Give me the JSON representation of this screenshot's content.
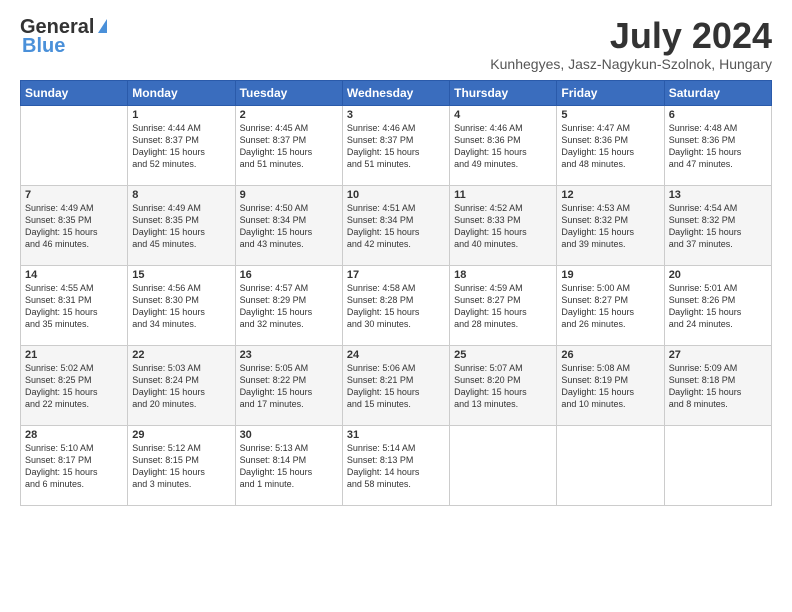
{
  "logo": {
    "line1": "General",
    "line2": "Blue"
  },
  "title": "July 2024",
  "location": "Kunhegyes, Jasz-Nagykun-Szolnok, Hungary",
  "days_header": [
    "Sunday",
    "Monday",
    "Tuesday",
    "Wednesday",
    "Thursday",
    "Friday",
    "Saturday"
  ],
  "weeks": [
    [
      {
        "day": "",
        "info": ""
      },
      {
        "day": "1",
        "info": "Sunrise: 4:44 AM\nSunset: 8:37 PM\nDaylight: 15 hours\nand 52 minutes."
      },
      {
        "day": "2",
        "info": "Sunrise: 4:45 AM\nSunset: 8:37 PM\nDaylight: 15 hours\nand 51 minutes."
      },
      {
        "day": "3",
        "info": "Sunrise: 4:46 AM\nSunset: 8:37 PM\nDaylight: 15 hours\nand 51 minutes."
      },
      {
        "day": "4",
        "info": "Sunrise: 4:46 AM\nSunset: 8:36 PM\nDaylight: 15 hours\nand 49 minutes."
      },
      {
        "day": "5",
        "info": "Sunrise: 4:47 AM\nSunset: 8:36 PM\nDaylight: 15 hours\nand 48 minutes."
      },
      {
        "day": "6",
        "info": "Sunrise: 4:48 AM\nSunset: 8:36 PM\nDaylight: 15 hours\nand 47 minutes."
      }
    ],
    [
      {
        "day": "7",
        "info": "Sunrise: 4:49 AM\nSunset: 8:35 PM\nDaylight: 15 hours\nand 46 minutes."
      },
      {
        "day": "8",
        "info": "Sunrise: 4:49 AM\nSunset: 8:35 PM\nDaylight: 15 hours\nand 45 minutes."
      },
      {
        "day": "9",
        "info": "Sunrise: 4:50 AM\nSunset: 8:34 PM\nDaylight: 15 hours\nand 43 minutes."
      },
      {
        "day": "10",
        "info": "Sunrise: 4:51 AM\nSunset: 8:34 PM\nDaylight: 15 hours\nand 42 minutes."
      },
      {
        "day": "11",
        "info": "Sunrise: 4:52 AM\nSunset: 8:33 PM\nDaylight: 15 hours\nand 40 minutes."
      },
      {
        "day": "12",
        "info": "Sunrise: 4:53 AM\nSunset: 8:32 PM\nDaylight: 15 hours\nand 39 minutes."
      },
      {
        "day": "13",
        "info": "Sunrise: 4:54 AM\nSunset: 8:32 PM\nDaylight: 15 hours\nand 37 minutes."
      }
    ],
    [
      {
        "day": "14",
        "info": "Sunrise: 4:55 AM\nSunset: 8:31 PM\nDaylight: 15 hours\nand 35 minutes."
      },
      {
        "day": "15",
        "info": "Sunrise: 4:56 AM\nSunset: 8:30 PM\nDaylight: 15 hours\nand 34 minutes."
      },
      {
        "day": "16",
        "info": "Sunrise: 4:57 AM\nSunset: 8:29 PM\nDaylight: 15 hours\nand 32 minutes."
      },
      {
        "day": "17",
        "info": "Sunrise: 4:58 AM\nSunset: 8:28 PM\nDaylight: 15 hours\nand 30 minutes."
      },
      {
        "day": "18",
        "info": "Sunrise: 4:59 AM\nSunset: 8:27 PM\nDaylight: 15 hours\nand 28 minutes."
      },
      {
        "day": "19",
        "info": "Sunrise: 5:00 AM\nSunset: 8:27 PM\nDaylight: 15 hours\nand 26 minutes."
      },
      {
        "day": "20",
        "info": "Sunrise: 5:01 AM\nSunset: 8:26 PM\nDaylight: 15 hours\nand 24 minutes."
      }
    ],
    [
      {
        "day": "21",
        "info": "Sunrise: 5:02 AM\nSunset: 8:25 PM\nDaylight: 15 hours\nand 22 minutes."
      },
      {
        "day": "22",
        "info": "Sunrise: 5:03 AM\nSunset: 8:24 PM\nDaylight: 15 hours\nand 20 minutes."
      },
      {
        "day": "23",
        "info": "Sunrise: 5:05 AM\nSunset: 8:22 PM\nDaylight: 15 hours\nand 17 minutes."
      },
      {
        "day": "24",
        "info": "Sunrise: 5:06 AM\nSunset: 8:21 PM\nDaylight: 15 hours\nand 15 minutes."
      },
      {
        "day": "25",
        "info": "Sunrise: 5:07 AM\nSunset: 8:20 PM\nDaylight: 15 hours\nand 13 minutes."
      },
      {
        "day": "26",
        "info": "Sunrise: 5:08 AM\nSunset: 8:19 PM\nDaylight: 15 hours\nand 10 minutes."
      },
      {
        "day": "27",
        "info": "Sunrise: 5:09 AM\nSunset: 8:18 PM\nDaylight: 15 hours\nand 8 minutes."
      }
    ],
    [
      {
        "day": "28",
        "info": "Sunrise: 5:10 AM\nSunset: 8:17 PM\nDaylight: 15 hours\nand 6 minutes."
      },
      {
        "day": "29",
        "info": "Sunrise: 5:12 AM\nSunset: 8:15 PM\nDaylight: 15 hours\nand 3 minutes."
      },
      {
        "day": "30",
        "info": "Sunrise: 5:13 AM\nSunset: 8:14 PM\nDaylight: 15 hours\nand 1 minute."
      },
      {
        "day": "31",
        "info": "Sunrise: 5:14 AM\nSunset: 8:13 PM\nDaylight: 14 hours\nand 58 minutes."
      },
      {
        "day": "",
        "info": ""
      },
      {
        "day": "",
        "info": ""
      },
      {
        "day": "",
        "info": ""
      }
    ]
  ]
}
